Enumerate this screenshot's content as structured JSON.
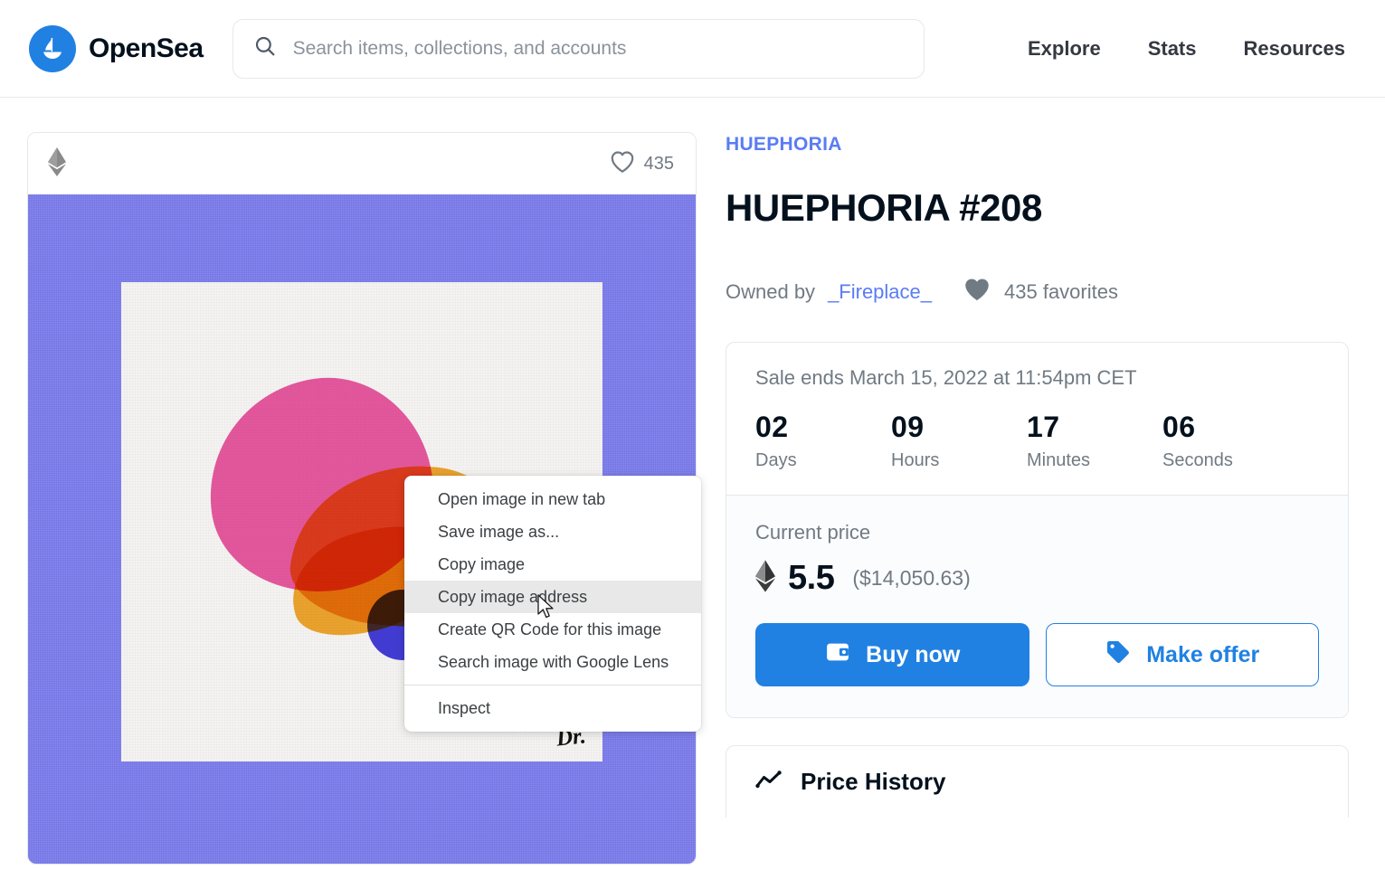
{
  "header": {
    "brand_name": "OpenSea",
    "brand_logo_icon": "opensea-sailboat-icon",
    "search": {
      "placeholder": "Search items, collections, and accounts",
      "value": "",
      "icon": "search-icon"
    },
    "nav_links": [
      {
        "label": "Explore"
      },
      {
        "label": "Stats"
      },
      {
        "label": "Resources"
      }
    ]
  },
  "nft_card": {
    "chain_icon": "ethereum-icon",
    "favorite_icon": "heart-outline-icon",
    "favorite_count": "435",
    "artwork": {
      "background_color": "#7b7bef",
      "canvas_color": "#f4f3f1",
      "shapes": [
        {
          "name": "pink-blob",
          "color": "#ed4e9e"
        },
        {
          "name": "orange-blob",
          "color": "#f5a623"
        },
        {
          "name": "blue-circle",
          "color": "#3b34e0"
        }
      ],
      "signature": "Dr."
    }
  },
  "details": {
    "collection": "HUEPHORIA",
    "title": "HUEPHORIA #208",
    "owned_by_label": "Owned by",
    "owner": "_Fireplace_",
    "favorites_icon": "heart-filled-icon",
    "favorites_text": "435 favorites",
    "sale": {
      "ends_text": "Sale ends March 15, 2022 at 11:54pm CET",
      "countdown": [
        {
          "value": "02",
          "label": "Days"
        },
        {
          "value": "09",
          "label": "Hours"
        },
        {
          "value": "17",
          "label": "Minutes"
        },
        {
          "value": "06",
          "label": "Seconds"
        }
      ]
    },
    "price": {
      "label": "Current price",
      "currency_icon": "ethereum-icon",
      "eth": "5.5",
      "usd": "($14,050.63)"
    },
    "buttons": {
      "buy": {
        "label": "Buy now",
        "icon": "wallet-icon",
        "color": "#2081e2"
      },
      "offer": {
        "label": "Make offer",
        "icon": "tag-icon",
        "color": "#2081e2"
      }
    },
    "price_history": {
      "icon": "line-chart-icon",
      "title": "Price History"
    }
  },
  "context_menu": {
    "items": [
      {
        "label": "Open image in new tab",
        "highlighted": false
      },
      {
        "label": "Save image as...",
        "highlighted": false
      },
      {
        "label": "Copy image",
        "highlighted": false
      },
      {
        "label": "Copy image address",
        "highlighted": true
      },
      {
        "label": "Create QR Code for this image",
        "highlighted": false
      },
      {
        "label": "Search image with Google Lens",
        "highlighted": false
      }
    ],
    "footer_items": [
      {
        "label": "Inspect",
        "highlighted": false
      }
    ]
  }
}
